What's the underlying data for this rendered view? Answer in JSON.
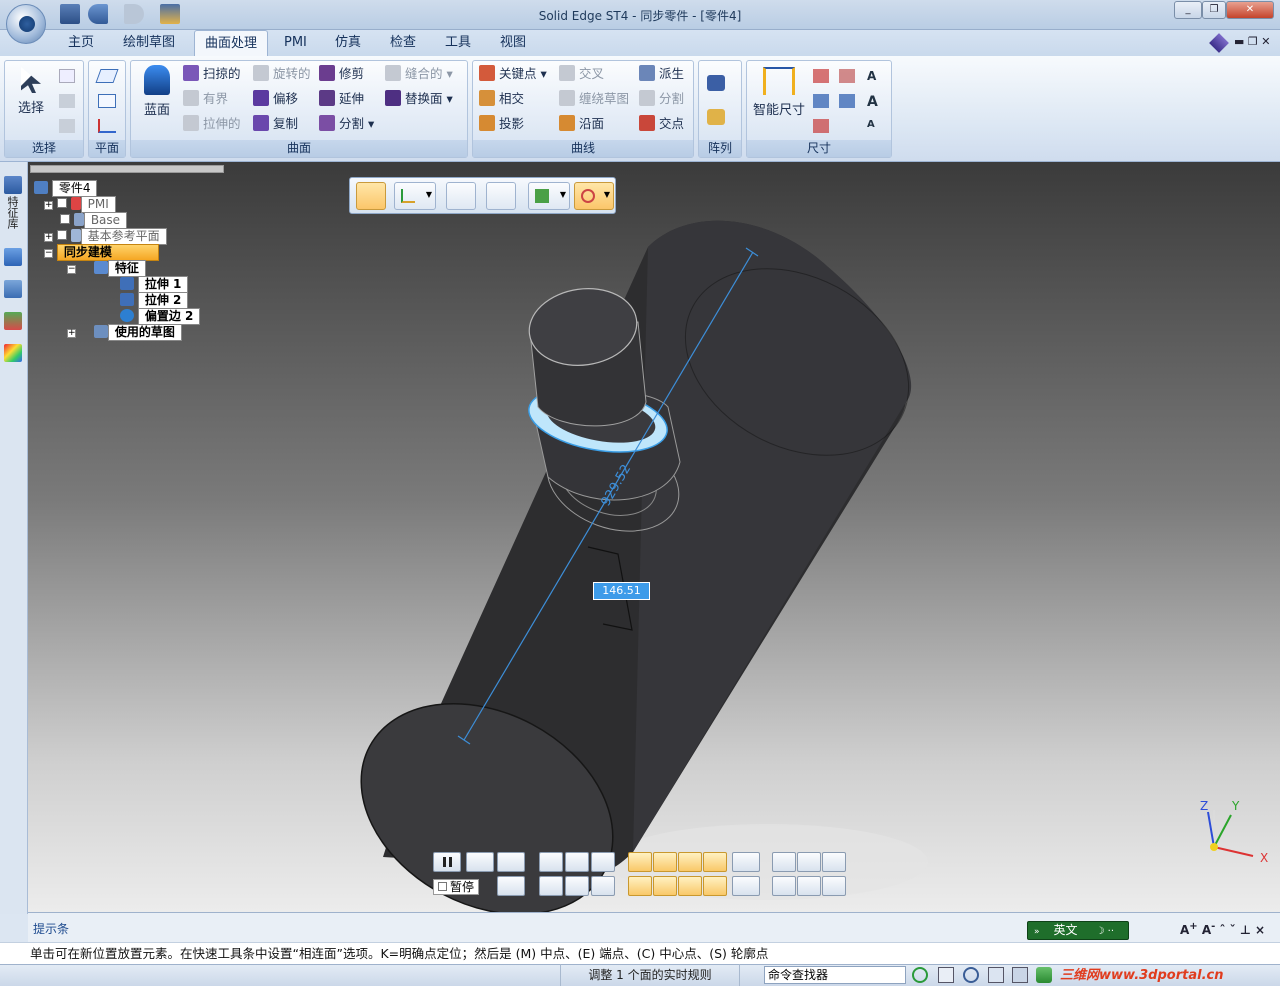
{
  "window": {
    "title": "Solid Edge ST4 - 同步零件 - [零件4]",
    "controls": [
      "minimize",
      "restore",
      "close"
    ]
  },
  "tabs": [
    {
      "label": "主页",
      "active": false
    },
    {
      "label": "绘制草图",
      "active": false
    },
    {
      "label": "曲面处理",
      "active": true
    },
    {
      "label": "PMI",
      "active": false
    },
    {
      "label": "仿真",
      "active": false
    },
    {
      "label": "检查",
      "active": false
    },
    {
      "label": "工具",
      "active": false
    },
    {
      "label": "视图",
      "active": false
    }
  ],
  "ribbon": {
    "select": {
      "label": "选择",
      "big_button": "选择"
    },
    "plane": {
      "label": "平面"
    },
    "surface": {
      "label": "曲面",
      "big_button": "蓝面",
      "col1": [
        "扫掠的",
        "有界",
        "拉伸的"
      ],
      "col2": [
        "旋转的",
        "偏移",
        "复制"
      ],
      "col3": [
        "修剪",
        "延伸",
        "分割"
      ],
      "col4": [
        "缝合的",
        "替换面"
      ]
    },
    "curve": {
      "label": "曲线",
      "col1": [
        "关键点",
        "相交",
        "投影"
      ],
      "col2": [
        "交叉",
        "缠绕草图",
        "沿面"
      ],
      "col3": [
        "派生",
        "分割",
        "交点"
      ]
    },
    "pattern": {
      "label": "阵列"
    },
    "dimension": {
      "label": "尺寸",
      "big_button": "智能尺寸"
    }
  },
  "leftstrip": {
    "tab_label": "特征库"
  },
  "tree": {
    "root": "零件4",
    "items": [
      {
        "label": "PMI"
      },
      {
        "label": "Base"
      },
      {
        "label": "基本参考平面"
      },
      {
        "label": "同步建模"
      },
      {
        "label": "特征"
      },
      {
        "label": "拉伸 1"
      },
      {
        "label": "拉伸 2"
      },
      {
        "label": "偏置边 2"
      },
      {
        "label": "使用的草图"
      }
    ]
  },
  "viewport": {
    "dimension_value": "929.52",
    "input_value": "146.51",
    "pause_label": "暂停",
    "triad": {
      "x": "X",
      "y": "Y",
      "z": "Z"
    }
  },
  "prompt": {
    "title": "提示条",
    "ime": "英文",
    "text": "单击可在新位置放置元素。在快速工具条中设置“相连面”选项。K=明确点定位；然后是 (M) 中点、(E) 端点、(C) 中心点、(S) 轮廓点"
  },
  "status": {
    "message": "调整 1 个面的实时规则",
    "command_finder": "命令查找器",
    "watermark": "三维网www.3dportal.cn"
  }
}
